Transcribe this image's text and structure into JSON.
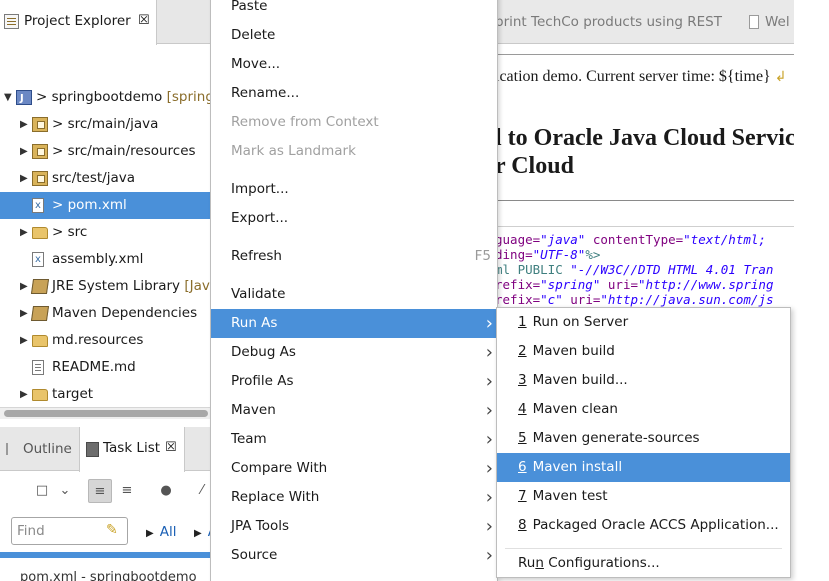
{
  "project_explorer": {
    "title": "Project Explorer",
    "close_glyph": "☒",
    "tree": [
      {
        "label": "> springbootdemo",
        "decoration": " [springb",
        "expanded": true,
        "icon": "project-icon"
      },
      {
        "label": "> src/main/java",
        "expanded": false,
        "icon": "package-folder-icon"
      },
      {
        "label": "> src/main/resources",
        "expanded": false,
        "icon": "package-folder-icon"
      },
      {
        "label": "src/test/java",
        "expanded": false,
        "icon": "package-folder-icon"
      },
      {
        "label": "> pom.xml",
        "selected": true,
        "icon": "xml-file-icon"
      },
      {
        "label": "> src",
        "expanded": false,
        "icon": "folder-icon"
      },
      {
        "label": "assembly.xml",
        "icon": "xml-file-icon"
      },
      {
        "label": "JRE System Library",
        "decoration": " [Java",
        "expanded": false,
        "icon": "library-icon"
      },
      {
        "label": "Maven Dependencies",
        "expanded": false,
        "icon": "library-icon"
      },
      {
        "label": "md.resources",
        "expanded": false,
        "icon": "folder-icon"
      },
      {
        "label": "README.md",
        "icon": "file-icon"
      },
      {
        "label": "target",
        "expanded": false,
        "icon": "folder-icon"
      }
    ]
  },
  "task_panel": {
    "tabs": [
      {
        "label": "Outline",
        "active": false
      },
      {
        "label": "Task List",
        "active": true
      }
    ],
    "close_glyph": "☒",
    "find_placeholder": "Find",
    "filter_all": "All",
    "filter_activate": "Ac",
    "status_text": "pom.xml - springbootdemo"
  },
  "editor": {
    "tabs": [
      "print TechCo products using REST",
      "Wel"
    ],
    "preview_text": "ication demo. Current server time: ${time}",
    "heading_line1": "l to Oracle Java Cloud Servic",
    "heading_line2": "r Cloud",
    "code_lines": [
      {
        "parts": [
          [
            "c-attr",
            "guage="
          ],
          [
            "c-str",
            "\"java\""
          ],
          [
            "c-plain",
            " "
          ],
          [
            "c-attr",
            "contentType="
          ],
          [
            "c-str",
            "\"text/html;"
          ]
        ]
      },
      {
        "parts": [
          [
            "c-attr",
            "ding="
          ],
          [
            "c-str",
            "\"UTF-8\""
          ],
          [
            "c-tag",
            "%>"
          ]
        ]
      },
      {
        "parts": [
          [
            "c-tag",
            "ml PUBLIC "
          ],
          [
            "c-str",
            "\"-//W3C//DTD HTML 4.01 Tran"
          ]
        ]
      },
      {
        "parts": [
          [
            "c-attr",
            "refix="
          ],
          [
            "c-str",
            "\"spring\""
          ],
          [
            "c-plain",
            " "
          ],
          [
            "c-attr",
            "uri="
          ],
          [
            "c-str",
            "\"http://www.spring"
          ]
        ]
      },
      {
        "parts": [
          [
            "c-attr",
            "refix="
          ],
          [
            "c-str",
            "\"c\""
          ],
          [
            "c-plain",
            " "
          ],
          [
            "c-attr",
            "uri="
          ],
          [
            "c-str",
            "\"http://java.sun.com/js"
          ]
        ]
      }
    ]
  },
  "context_menu": {
    "items": [
      {
        "label": "Paste"
      },
      {
        "label": "Delete"
      },
      {
        "label": "Move..."
      },
      {
        "label": "Rename..."
      },
      {
        "label": "Remove from Context",
        "disabled": true
      },
      {
        "label": "Mark as Landmark",
        "disabled": true
      },
      {
        "label": "Import..."
      },
      {
        "label": "Export..."
      },
      {
        "label": "Refresh",
        "shortcut": "F5"
      },
      {
        "label": "Validate"
      },
      {
        "label": "Run As",
        "submenu": true,
        "highlighted": true
      },
      {
        "label": "Debug As",
        "submenu": true
      },
      {
        "label": "Profile As",
        "submenu": true
      },
      {
        "label": "Maven",
        "submenu": true
      },
      {
        "label": "Team",
        "submenu": true
      },
      {
        "label": "Compare With",
        "submenu": true
      },
      {
        "label": "Replace With",
        "submenu": true
      },
      {
        "label": "JPA Tools",
        "submenu": true
      },
      {
        "label": "Source",
        "submenu": true
      }
    ]
  },
  "run_as_submenu": {
    "items": [
      {
        "mnemonic": "1",
        "label": "Run on Server"
      },
      {
        "mnemonic": "2",
        "label": "Maven build"
      },
      {
        "mnemonic": "3",
        "label": "Maven build..."
      },
      {
        "mnemonic": "4",
        "label": "Maven clean"
      },
      {
        "mnemonic": "5",
        "label": "Maven generate-sources"
      },
      {
        "mnemonic": "6",
        "label": "Maven install",
        "highlighted": true
      },
      {
        "mnemonic": "7",
        "label": "Maven test"
      },
      {
        "mnemonic": "8",
        "label": "Packaged Oracle ACCS Application..."
      }
    ],
    "run_configurations": {
      "prefix": "Ru",
      "mnemonic": "n",
      "suffix": " Configurations..."
    }
  },
  "colors": {
    "selection": "#4a90d9",
    "tab_bar": "#e7e7e7"
  }
}
